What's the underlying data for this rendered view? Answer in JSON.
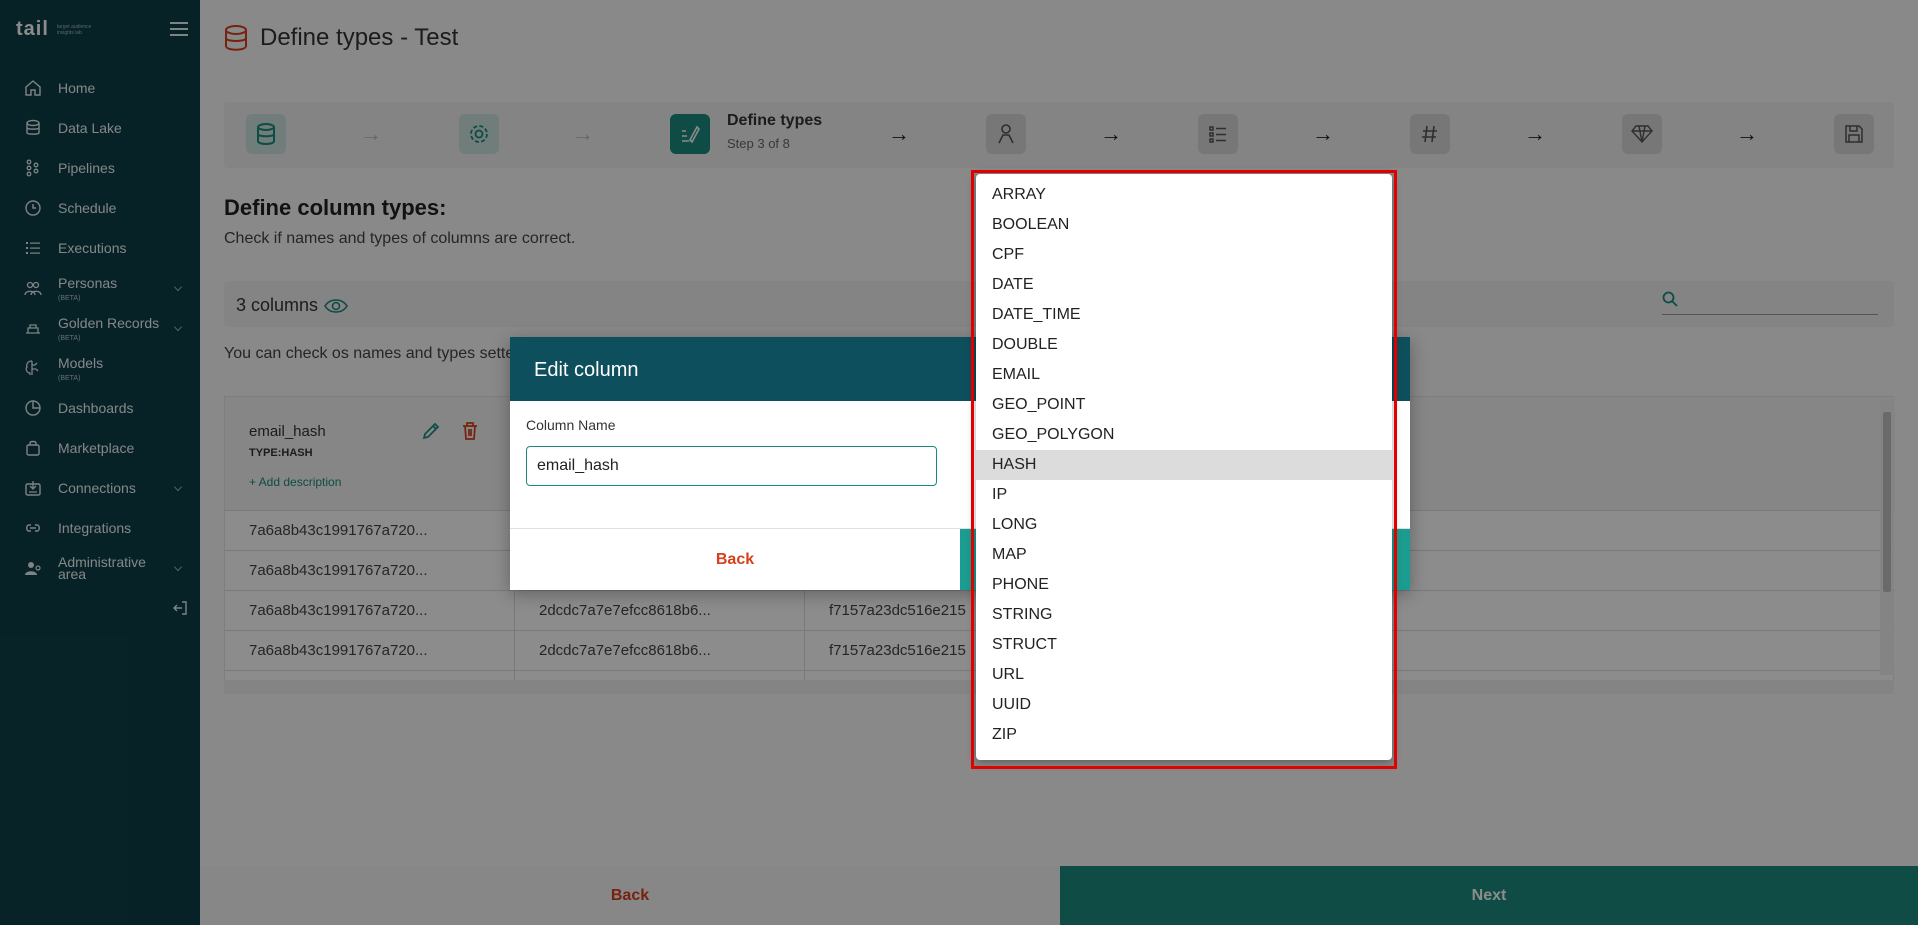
{
  "sidebar": {
    "logo": "tail",
    "logo_sub": "target audience insights lab",
    "items": [
      {
        "label": "Home",
        "beta": "",
        "icon": "home-icon"
      },
      {
        "label": "Data Lake",
        "beta": "",
        "icon": "database-icon"
      },
      {
        "label": "Pipelines",
        "beta": "",
        "icon": "pipeline-icon"
      },
      {
        "label": "Schedule",
        "beta": "",
        "icon": "clock-icon"
      },
      {
        "label": "Executions",
        "beta": "",
        "icon": "list-icon"
      },
      {
        "label": "Personas",
        "beta": "(BETA)",
        "icon": "people-icon"
      },
      {
        "label": "Golden Records",
        "beta": "(BETA)",
        "icon": "records-icon"
      },
      {
        "label": "Models",
        "beta": "(BETA)",
        "icon": "brain-icon"
      },
      {
        "label": "Dashboards",
        "beta": "",
        "icon": "pie-chart-icon"
      },
      {
        "label": "Marketplace",
        "beta": "",
        "icon": "bag-icon"
      },
      {
        "label": "Connections",
        "beta": "",
        "icon": "connection-icon"
      },
      {
        "label": "Integrations",
        "beta": "",
        "icon": "link-icon"
      },
      {
        "label": "Administrative area",
        "beta": "",
        "icon": "admin-icon"
      }
    ]
  },
  "page": {
    "title": "Define types - Test",
    "stepper": {
      "current_title": "Define types",
      "current_sub": "Step 3 of 8"
    },
    "section_title": "Define column types:",
    "section_desc": "Check if names and types of columns are correct.",
    "columns_count": "3 columns",
    "note": "You can check os names and types sette"
  },
  "table": {
    "column": {
      "name": "email_hash",
      "type": "TYPE:HASH",
      "add_desc": "+ Add description"
    },
    "rows": [
      [
        "7a6a8b43c1991767a720...",
        "",
        ""
      ],
      [
        "7a6a8b43c1991767a720...",
        "",
        ""
      ],
      [
        "7a6a8b43c1991767a720...",
        "2dcdc7a7e7efcc8618b6...",
        "f7157a23dc516e215"
      ],
      [
        "7a6a8b43c1991767a720...",
        "2dcdc7a7e7efcc8618b6...",
        "f7157a23dc516e215"
      ]
    ]
  },
  "footer": {
    "back": "Back",
    "next": "Next"
  },
  "modal": {
    "title": "Edit column",
    "field_label": "Column Name",
    "field_value": "email_hash",
    "back": "Back"
  },
  "dropdown": {
    "options": [
      "ARRAY",
      "BOOLEAN",
      "CPF",
      "DATE",
      "DATE_TIME",
      "DOUBLE",
      "EMAIL",
      "GEO_POINT",
      "GEO_POLYGON",
      "HASH",
      "IP",
      "LONG",
      "MAP",
      "PHONE",
      "STRING",
      "STRUCT",
      "URL",
      "UUID",
      "ZIP"
    ],
    "selected": "HASH"
  },
  "colors": {
    "sidebar": "#0d3f47",
    "accent": "#1a8a7e",
    "danger": "#d6401a",
    "modal_header": "#0d4f5c",
    "highlight": "#e00000"
  }
}
